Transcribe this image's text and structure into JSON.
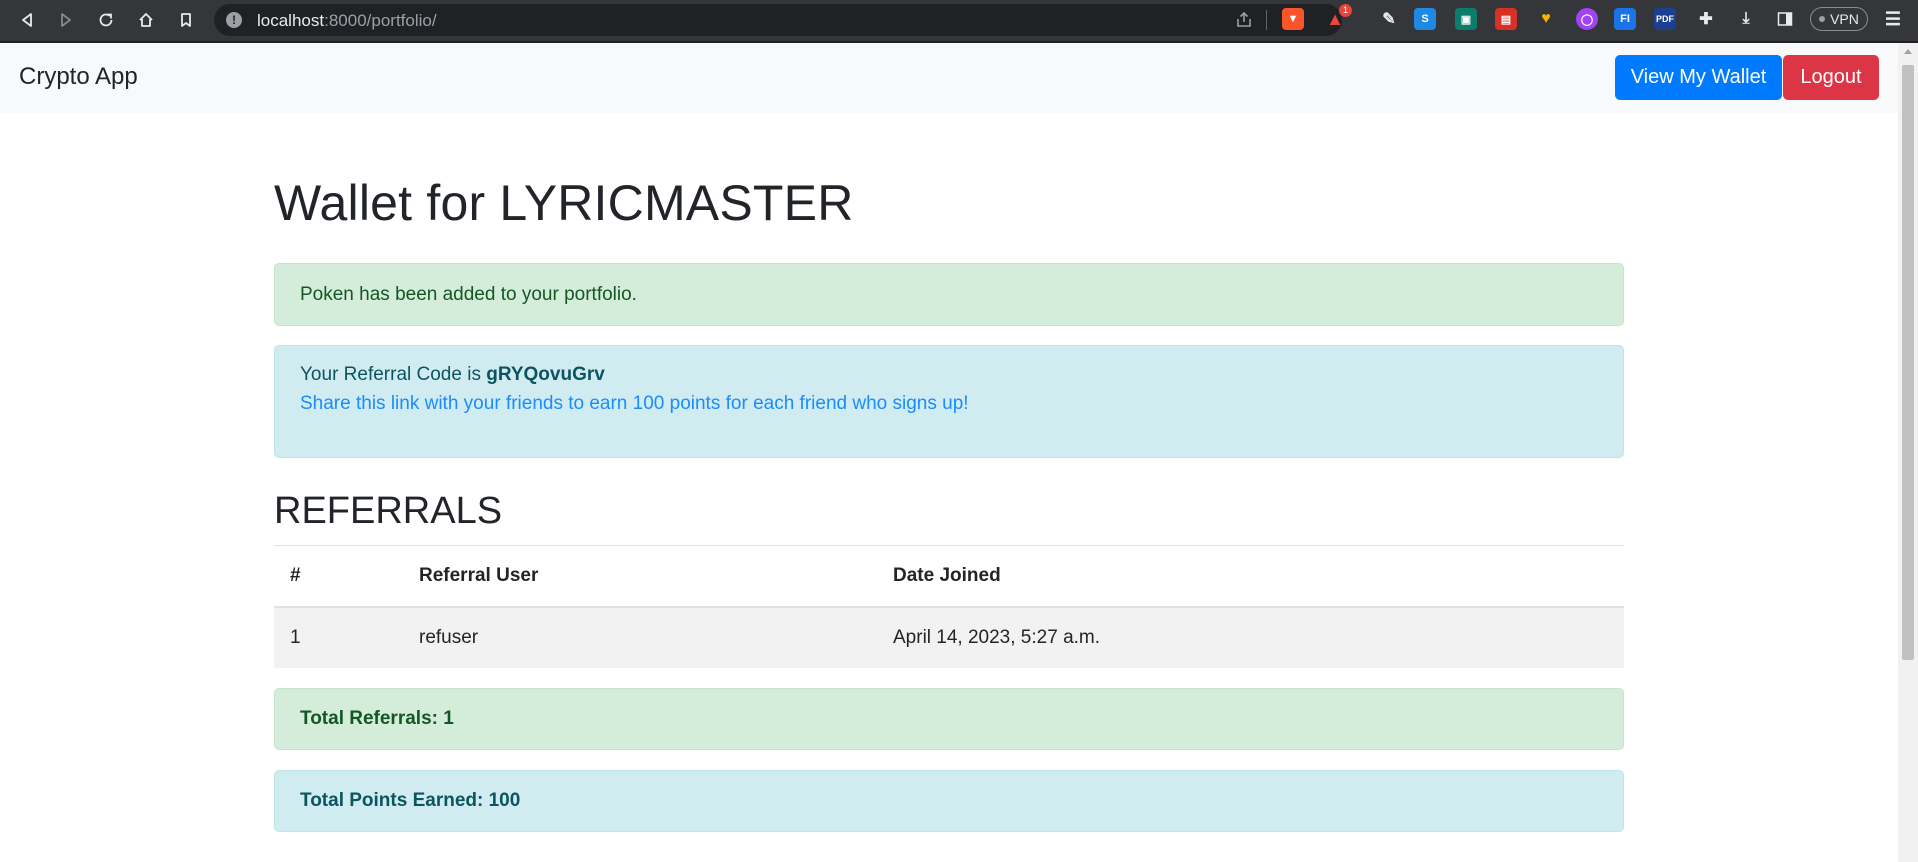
{
  "browser": {
    "url_host": "localhost",
    "url_rest": ":8000/portfolio/",
    "extension_badge": "1",
    "vpn_label": "VPN"
  },
  "navbar": {
    "brand": "Crypto App",
    "wallet_button": "View My Wallet",
    "logout_button": "Logout"
  },
  "page": {
    "title": "Wallet for LYRICMASTER",
    "success_message": "Poken has been added to your portfolio.",
    "referral": {
      "prefix": "Your Referral Code is ",
      "code": "gRYQovuGrv",
      "share_text": "Share this link with your friends to earn 100 points for each friend who signs up!"
    },
    "referrals_heading": "REFERRALS",
    "table": {
      "headers": [
        "#",
        "Referral User",
        "Date Joined"
      ],
      "rows": [
        [
          "1",
          "refuser",
          "April 14, 2023, 5:27 a.m."
        ]
      ]
    },
    "total_referrals": "Total Referrals: 1",
    "total_points": "Total Points Earned: 100"
  },
  "colors": {
    "primary": "#007bff",
    "danger": "#dc3545",
    "success_bg": "#d4edda",
    "info_bg": "#d1ecf1"
  }
}
